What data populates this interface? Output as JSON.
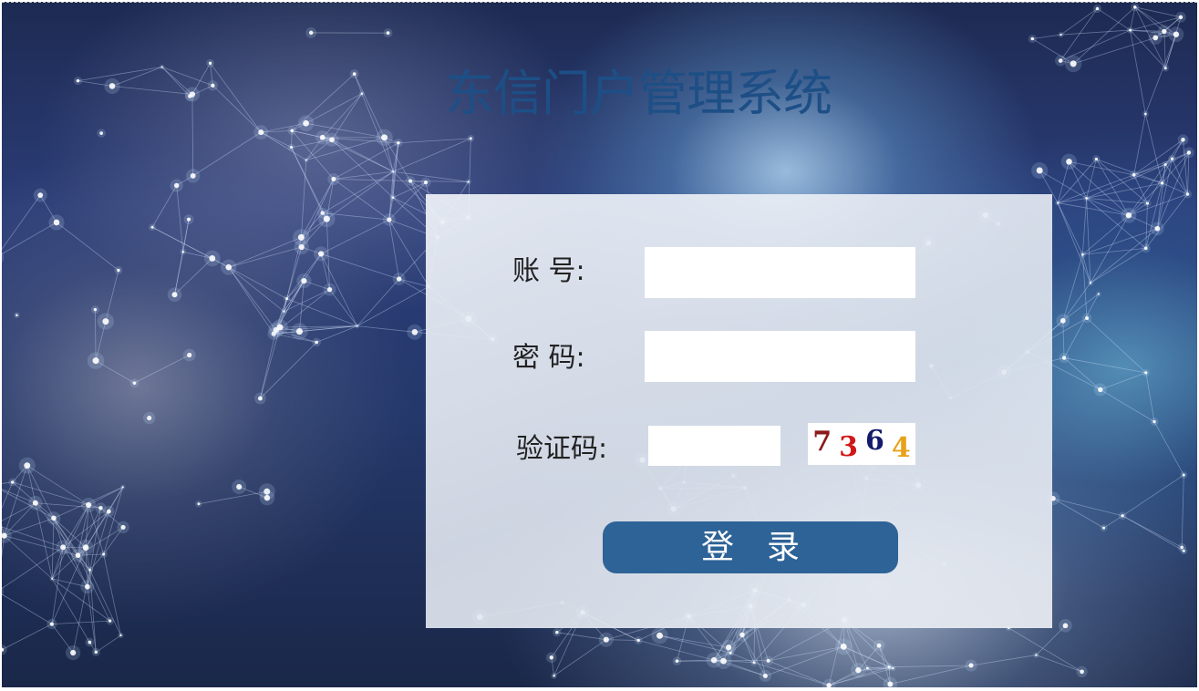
{
  "app": {
    "title": "东信门户管理系统"
  },
  "login_form": {
    "account_label": "账 号:",
    "account_value": "",
    "password_label": "密 码:",
    "password_value": "",
    "captcha_label": "验证码:",
    "captcha_value": "",
    "captcha_code": {
      "digits": [
        "7",
        "3",
        "6",
        "4"
      ],
      "colors": [
        "#8b1a1a",
        "#d01818",
        "#141a6b",
        "#e6a21a"
      ]
    },
    "login_button_label": "登录"
  },
  "colors": {
    "title": "#1d4f86",
    "button": "#2e6397",
    "panel": "#e6ebf2"
  }
}
